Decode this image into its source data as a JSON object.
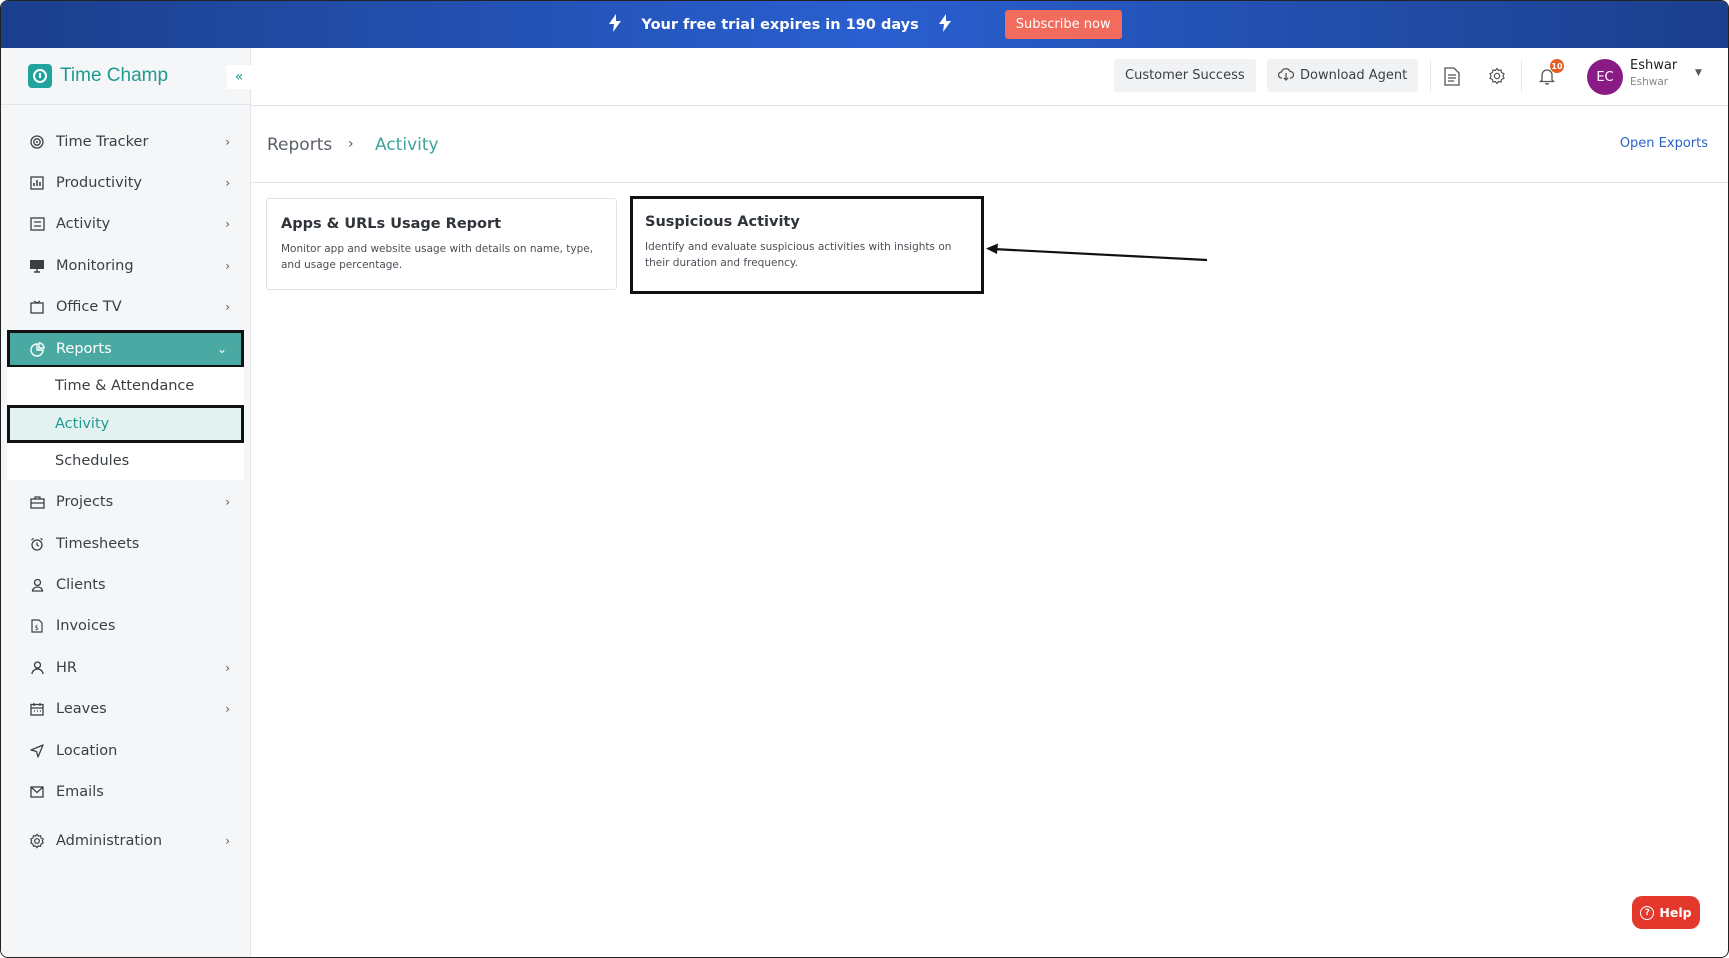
{
  "banner": {
    "trial_text": "Your free trial expires in 190 days",
    "subscribe_label": "Subscribe now"
  },
  "brand": {
    "name": "Time Champ",
    "collapse_symbol": "«"
  },
  "sidebar": {
    "items": [
      {
        "label": "Time Tracker",
        "icon": "target-icon",
        "has_chevron": true
      },
      {
        "label": "Productivity",
        "icon": "bar-chart-icon",
        "has_chevron": true
      },
      {
        "label": "Activity",
        "icon": "activity-list-icon",
        "has_chevron": true
      },
      {
        "label": "Monitoring",
        "icon": "monitor-icon",
        "has_chevron": true
      },
      {
        "label": "Office TV",
        "icon": "tv-icon",
        "has_chevron": true
      },
      {
        "label": "Reports",
        "icon": "pie-chart-icon",
        "has_chevron": true,
        "expanded": true
      },
      {
        "label": "Projects",
        "icon": "briefcase-icon",
        "has_chevron": true
      },
      {
        "label": "Timesheets",
        "icon": "alarm-clock-icon",
        "has_chevron": false
      },
      {
        "label": "Clients",
        "icon": "user-icon",
        "has_chevron": false
      },
      {
        "label": "Invoices",
        "icon": "invoice-icon",
        "has_chevron": false
      },
      {
        "label": "HR",
        "icon": "person-icon",
        "has_chevron": true
      },
      {
        "label": "Leaves",
        "icon": "calendar-icon",
        "has_chevron": true
      },
      {
        "label": "Location",
        "icon": "navigation-icon",
        "has_chevron": false
      },
      {
        "label": "Emails",
        "icon": "mail-icon",
        "has_chevron": false
      },
      {
        "label": "Administration",
        "icon": "gear-icon",
        "has_chevron": true
      }
    ],
    "reports_submenu": [
      {
        "label": "Time & Attendance"
      },
      {
        "label": "Activity",
        "active": true
      },
      {
        "label": "Schedules"
      }
    ]
  },
  "header": {
    "customer_success_label": "Customer Success",
    "download_agent_label": "Download Agent",
    "notification_count": "10",
    "user": {
      "initials": "EC",
      "name": "Eshwar",
      "subtitle": "Eshwar"
    }
  },
  "breadcrumb": {
    "root": "Reports",
    "separator": "›",
    "current": "Activity",
    "open_exports_label": "Open Exports"
  },
  "cards": [
    {
      "title": "Apps & URLs Usage Report",
      "description": "Monitor app and website usage with details on name, type, and usage percentage."
    },
    {
      "title": "Suspicious Activity",
      "description": "Identify and evaluate suspicious activities with insights on their duration and frequency."
    }
  ],
  "help_label": "Help",
  "colors": {
    "brand_teal": "#1fa39a",
    "active_nav": "#4aa9a2",
    "banner_blue": "#2a5fd0",
    "subscribe": "#f26c5d",
    "help_red": "#e5382c",
    "avatar": "#8a1b86",
    "link_blue": "#2b63c4"
  }
}
